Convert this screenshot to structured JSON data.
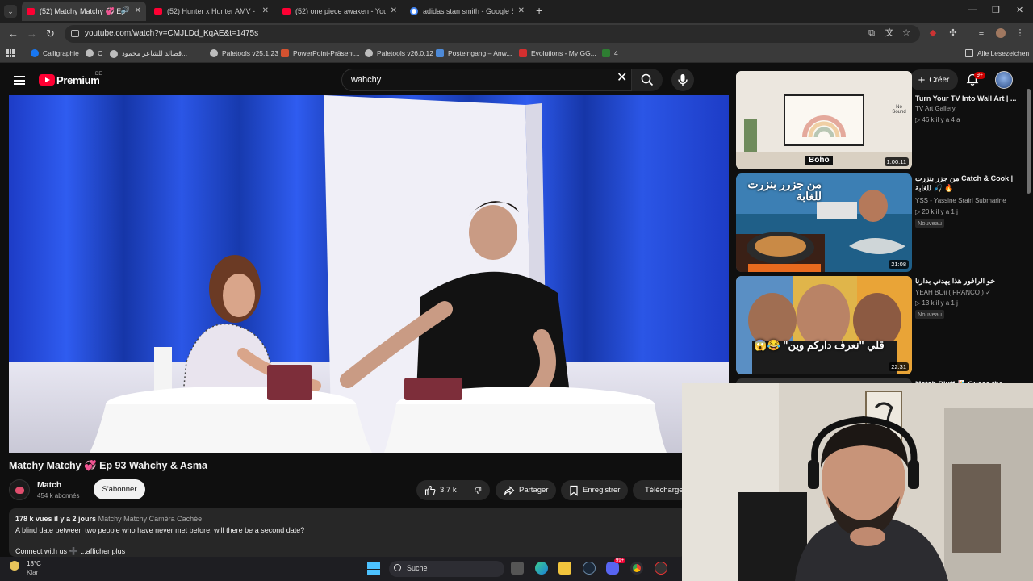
{
  "browser": {
    "tabs": [
      {
        "title": "(52) Matchy Matchy 💞 Ep",
        "active": true
      },
      {
        "title": "(52) Hunter x Hunter AMV - Ma",
        "active": false
      },
      {
        "title": "(52) one piece awaken - YouTu",
        "active": false
      },
      {
        "title": "adidas stan smith - Google Suc",
        "active": false
      }
    ],
    "new_tab": "+",
    "url": "youtube.com/watch?v=CMJLDd_KqAE&t=1475s",
    "bookmarks": [
      {
        "label": "Calligraphie",
        "color": "#1877f2"
      },
      {
        "label": "C",
        "color": "#bdbdbd"
      },
      {
        "label": "قصائد للشاعر محمود...",
        "color": "#bdbdbd"
      },
      {
        "label": "Paletools v25.1.23",
        "color": "#bdbdbd"
      },
      {
        "label": "PowerPoint-Präsent...",
        "color": "#d35230"
      },
      {
        "label": "Paletools v26.0.12",
        "color": "#bdbdbd"
      },
      {
        "label": "Posteingang – Anw...",
        "color": "#4d8ad8"
      },
      {
        "label": "Evolutions - My GG...",
        "color": "#d32f2f"
      },
      {
        "label": "4",
        "color": "#2e7d32"
      }
    ],
    "all_bookmarks": "Alle Lesezeichen"
  },
  "youtube": {
    "brand": "Premium",
    "region": "DE",
    "search_value": "wahchy",
    "create_label": "Créer",
    "notif_badge": "9+",
    "video": {
      "title": "Matchy Matchy 💞 Ep 93 Wahchy & Asma",
      "channel": "Match",
      "subscribers": "454 k abonnés",
      "subscribe": "S'abonner",
      "likes": "3,7 k",
      "share": "Partager",
      "save": "Enregistrer",
      "download": "Télécharger",
      "views_date": "178 k vues  il y a 2 jours",
      "tags": "Matchy Matchy Caméra Cachée",
      "description": "A blind date between two people who have never met before, will there be a second date?",
      "connect": "Connect with us ➕ ...afficher plus"
    },
    "recommendations": [
      {
        "title": "Turn Your TV Into Wall Art | ...",
        "channel": "TV Art Gallery",
        "meta": "▷ 46 k  il y a 4 a",
        "duration": "1:00:11",
        "badge": "",
        "thumb_text": "Boho",
        "thumb_extra": "No Sound"
      },
      {
        "title": "من جزر بنزرت Catch & Cook | للغابة 🎣 🔥",
        "channel": "YSS - Yassine Srairi Submarine",
        "meta": "▷ 20 k  il y a 1 j",
        "duration": "21:08",
        "badge": "Nouveau",
        "thumb_text": "من جزرر بنزرت للغابة",
        "thumb_extra": ""
      },
      {
        "title": "خو الرافور هذا يهدني بدارنا",
        "channel": "YEAH BOii ( FRANCO ) ✓",
        "meta": "▷ 13 k  il y a 1 j",
        "duration": "22:31",
        "badge": "Nouveau",
        "thumb_text": "قلي \"نعرف داركم وين\" 😂😱",
        "thumb_extra": ""
      },
      {
        "title": "Match Bluff 🃏 Guess the...",
        "channel": "",
        "meta": "",
        "duration": "",
        "badge": "",
        "thumb_text": "",
        "thumb_extra": ""
      }
    ]
  },
  "taskbar": {
    "temperature": "18°C",
    "weather": "Klar",
    "search_placeholder": "Suche",
    "chat_badge": "99+"
  },
  "colors": {
    "yt_red": "#ff0033",
    "background": "#0f0f0f",
    "pill": "#272727"
  }
}
